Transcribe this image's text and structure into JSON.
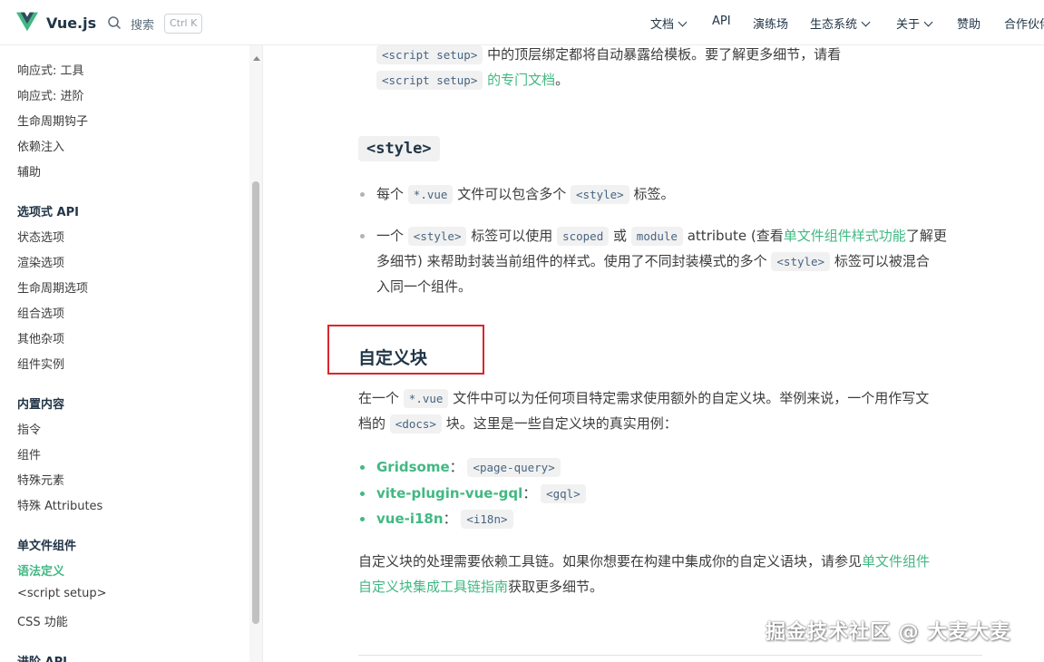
{
  "nav": {
    "brand": "Vue.js",
    "search_label": "搜索",
    "search_shortcut": "Ctrl K",
    "items": [
      {
        "label": "文档"
      },
      {
        "label": "API"
      },
      {
        "label": "演练场"
      },
      {
        "label": "生态系统"
      },
      {
        "label": "关于"
      },
      {
        "label": "赞助"
      },
      {
        "label": "合作伙伴"
      }
    ]
  },
  "sidebar": {
    "items": [
      "响应式: 工具",
      "响应式: 进阶",
      "生命周期钩子",
      "依赖注入",
      "辅助"
    ],
    "section_options": "选项式 API",
    "options_items": [
      "状态选项",
      "渲染选项",
      "生命周期选项",
      "组合选项",
      "其他杂项",
      "组件实例"
    ],
    "section_builtin": "内置内容",
    "builtin_items": [
      "指令",
      "组件",
      "特殊元素",
      "特殊 Attributes"
    ],
    "section_sfc": "单文件组件",
    "sfc_items": [
      "语法定义",
      "<script setup>",
      "CSS 功能"
    ],
    "section_advanced": "进阶 API"
  },
  "content": {
    "line1_code": "<script setup>",
    "line1_text": "中的顶层绑定都将自动暴露给模板。要了解更多细节，请看",
    "line2_code": "<script setup>",
    "line2_link": "的专门文档",
    "line2_end": "。",
    "style_heading": "<style>",
    "b1_a": "每个",
    "b1_code": "*.vue",
    "b1_b": "文件可以包含多个",
    "b1_code2": "<style>",
    "b1_c": "标签。",
    "b2_a": "一个",
    "b2_code1": "<style>",
    "b2_b": "标签可以使用",
    "b2_code2": "scoped",
    "b2_c": "或",
    "b2_code3": "module",
    "b2_d": "attribute (查看",
    "b2_link": "单文件组件样式功能",
    "b2_e": "了解更",
    "b2_l2_a": "多细节) 来帮助封装当前组件的样式。使用了不同封装模式的多个",
    "b2_l2_code": "<style>",
    "b2_l2_b": "标签可以被混合",
    "b2_l3": "入同一个组件。",
    "h3": "自定义块",
    "p1_a": "在一个",
    "p1_code": "*.vue",
    "p1_b": "文件中可以为任何项目特定需求使用额外的自定义块。举例来说，一个用作写文",
    "p1_l2_a": "档的",
    "p1_l2_code": "<docs>",
    "p1_l2_b": "块。这里是一些自定义块的真实用例：",
    "examples": [
      {
        "name": "Gridsome",
        "sep": "：",
        "code": "<page-query>"
      },
      {
        "name": "vite-plugin-vue-gql",
        "sep": "：",
        "code": "<gql>"
      },
      {
        "name": "vue-i18n",
        "sep": "：",
        "code": "<i18n>"
      }
    ],
    "p2_a": "自定义块的处理需要依赖工具链。如果你想要在构建中集成你的自定义语块，请参见",
    "p2_link1": "单文件组件",
    "p2_link2": "自定义块集成工具链指南",
    "p2_b": "获取更多细节。"
  },
  "watermark": "掘金技术社区 @ 大麦大麦",
  "colors": {
    "accent": "#42b883",
    "highlight": "#d9262c",
    "text": "#213547"
  }
}
